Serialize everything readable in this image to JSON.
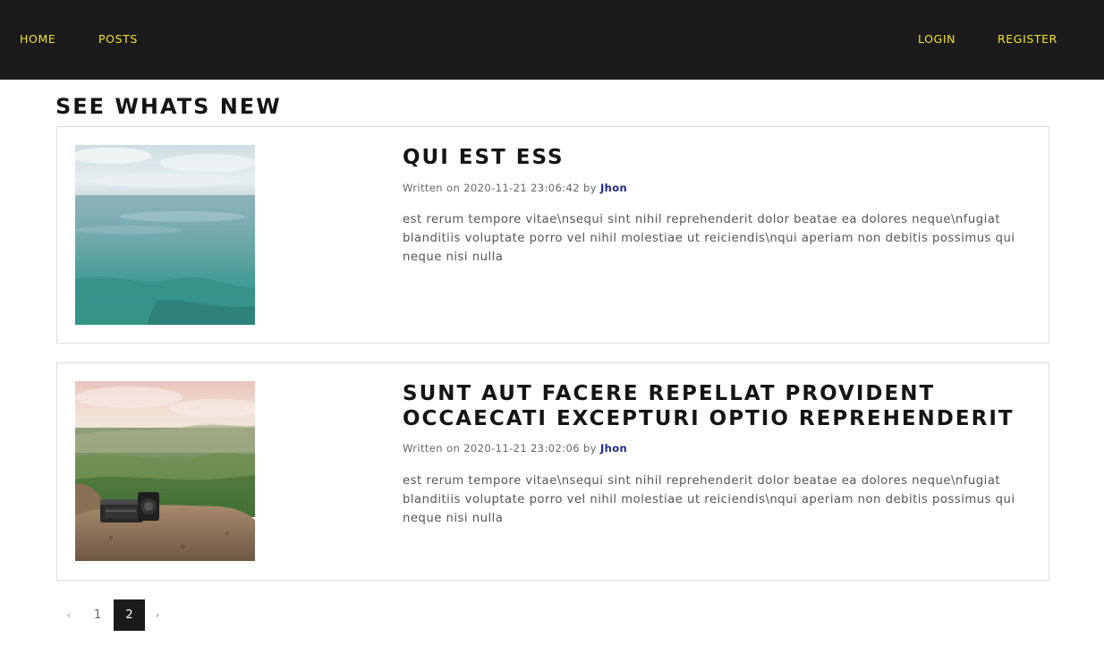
{
  "nav": {
    "left": [
      {
        "label": "HOME"
      },
      {
        "label": "POSTS"
      }
    ],
    "right": [
      {
        "label": "LOGIN"
      },
      {
        "label": "REGISTER"
      }
    ]
  },
  "main": {
    "title": "SEE WHATS NEW",
    "posts": [
      {
        "title": "QUI EST ESS",
        "written_prefix": "Written on",
        "date": "2020-11-21 23:06:42",
        "by": "by",
        "author": "Jhon",
        "excerpt": "est rerum tempore vitae\\nsequi sint nihil reprehenderit dolor beatae ea dolores neque\\nfugiat blanditiis voluptate porro vel nihil molestiae ut reiciendis\\nqui aperiam non debitis possimus qui neque nisi nulla",
        "thumbnail": "sea-image"
      },
      {
        "title": "SUNT AUT FACERE REPELLAT PROVIDENT OCCAECATI EXCEPTURI OPTIO REPREHENDERIT",
        "written_prefix": "Written on",
        "date": "2020-11-21 23:02:06",
        "by": "by",
        "author": "Jhon",
        "excerpt": "est rerum tempore vitae\\nsequi sint nihil reprehenderit dolor beatae ea dolores neque\\nfugiat blanditiis voluptate porro vel nihil molestiae ut reiciendis\\nqui aperiam non debitis possimus qui neque nisi nulla",
        "thumbnail": "camera-on-cliff-image"
      }
    ]
  },
  "pagination": {
    "prev": "‹",
    "pages": [
      "1",
      "2"
    ],
    "current": "2",
    "next": "›"
  },
  "colors": {
    "nav_bg": "#1b1b1b",
    "nav_link": "#f5e02a",
    "author_link": "#1f2a8a"
  }
}
